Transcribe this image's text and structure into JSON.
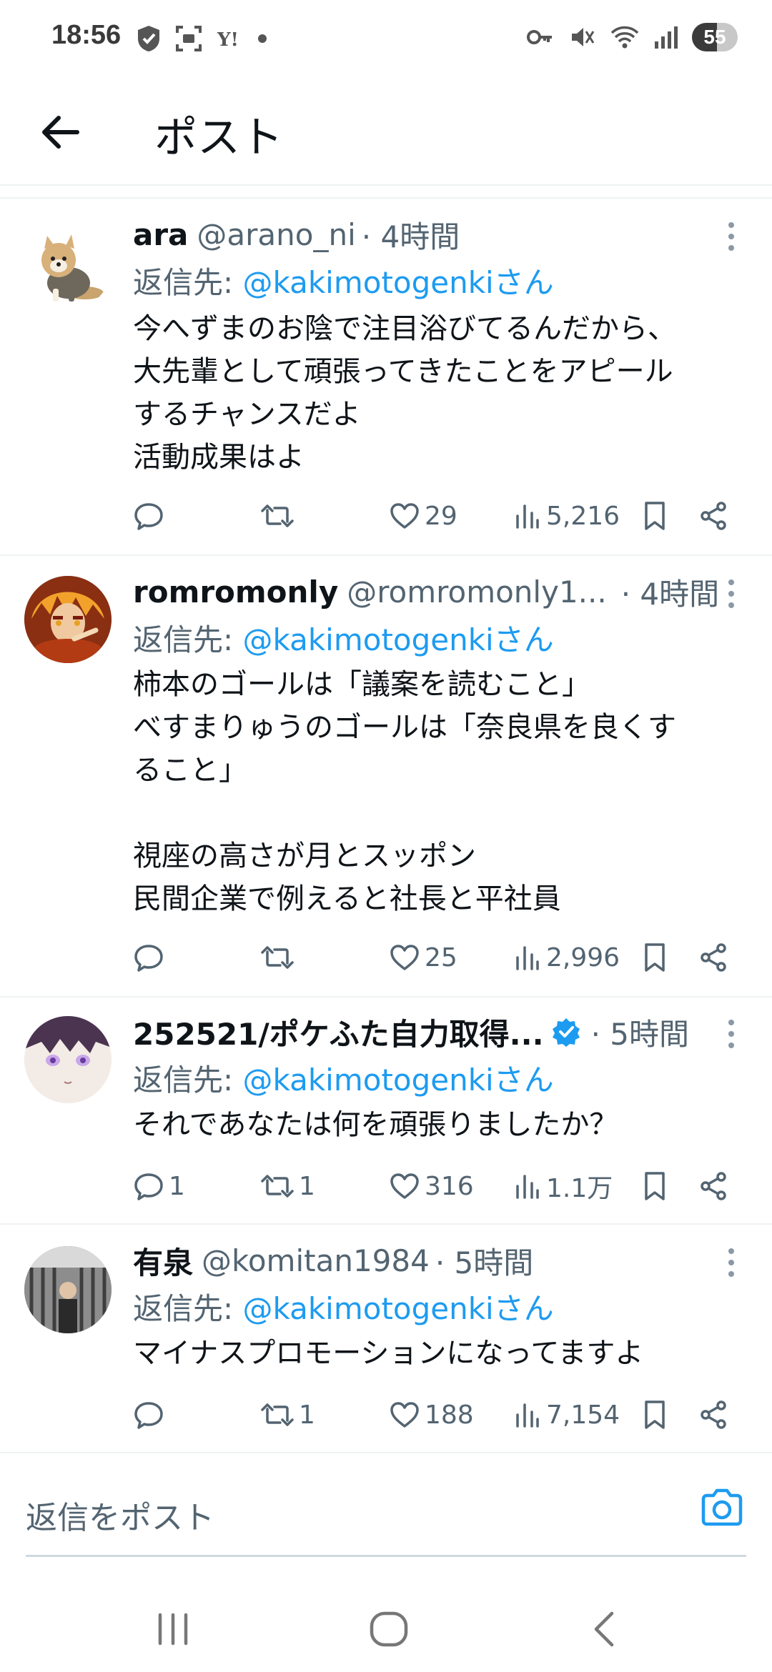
{
  "status_bar": {
    "time": "18:56",
    "battery": "55",
    "battery_level": 0.55
  },
  "header": {
    "title": "ポスト"
  },
  "tweets": [
    {
      "name": "ara",
      "handle": "@arano_ni",
      "time": "· 4時間",
      "reply_prefix": "返信先: ",
      "reply_mention": "@kakimotogenkiさん",
      "lines": [
        "今へずまのお陰で注目浴びてるんだから、",
        "大先輩として頑張ってきたことをアピール",
        "するチャンスだよ",
        "活動成果はよ"
      ],
      "replies": "",
      "reposts": "",
      "likes": "29",
      "views": "5,216"
    },
    {
      "name": "romromonly",
      "handle": "@romromonly1...",
      "time": "· 4時間",
      "reply_prefix": "返信先: ",
      "reply_mention": "@kakimotogenkiさん",
      "lines": [
        "柿本のゴールは「議案を読むこと」",
        "べすまりゅうのゴールは「奈良県を良くす",
        "ること」",
        "",
        "視座の高さが月とスッポン",
        "民間企業で例えると社長と平社員"
      ],
      "replies": "",
      "reposts": "",
      "likes": "25",
      "views": "2,996"
    },
    {
      "name": "252521/ポケふた自力取得...",
      "handle": "",
      "time": "· 5時間",
      "reply_prefix": "返信先: ",
      "reply_mention": "@kakimotogenkiさん",
      "lines": [
        "それであなたは何を頑張りましたか？"
      ],
      "replies": "1",
      "reposts": "1",
      "likes": "316",
      "views": "1.1万"
    },
    {
      "name": "有泉",
      "handle": "@komitan1984",
      "time": "· 5時間",
      "reply_prefix": "返信先: ",
      "reply_mention": "@kakimotogenkiさん",
      "lines": [
        "マイナスプロモーションになってますよ"
      ],
      "replies": "",
      "reposts": "1",
      "likes": "188",
      "views": "7,154"
    }
  ],
  "composer": {
    "placeholder": "返信をポスト"
  },
  "colors": {
    "accent": "#1d9bf0",
    "secondary_text": "#536471",
    "divider": "#eff3f4"
  }
}
